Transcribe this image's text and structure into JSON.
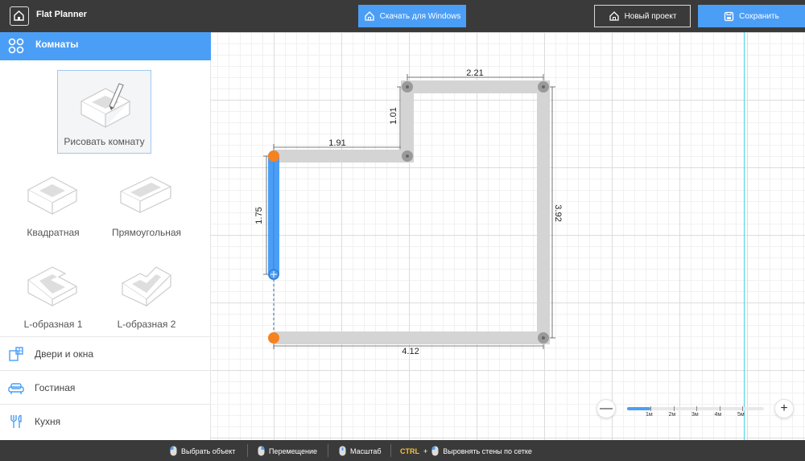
{
  "header": {
    "app_title": "Flat Planner",
    "download_label": "Скачать для Windows",
    "new_project_label": "Новый проект",
    "save_label": "Сохранить"
  },
  "sidebar": {
    "section_title": "Комнаты",
    "draw_room_label": "Рисовать комнату",
    "templates": [
      {
        "label": "Квадратная"
      },
      {
        "label": "Прямоугольная"
      },
      {
        "label": "L-образная 1"
      },
      {
        "label": "L-образная 2"
      }
    ],
    "categories": [
      {
        "label": "Двери и окна",
        "icon": "door-window-icon"
      },
      {
        "label": "Гостиная",
        "icon": "sofa-icon"
      },
      {
        "label": "Кухня",
        "icon": "cutlery-icon"
      }
    ]
  },
  "plan": {
    "dimensions": {
      "top": "2.21",
      "step_height": "1.01",
      "step_width": "1.91",
      "right": "3.92",
      "bottom": "4.12",
      "selected_wall": "1.75"
    }
  },
  "zoom": {
    "out_symbol": "—",
    "in_symbol": "+",
    "scale_fraction": 0.17,
    "ticks": [
      "1м",
      "2м",
      "3м",
      "4м",
      "5м"
    ]
  },
  "statusbar": {
    "select_hint": "Выбрать объект",
    "move_hint": "Перемещение",
    "zoom_hint": "Масштаб",
    "ctrl_key": "CTRL",
    "plus": "+",
    "align_hint": "Выровнять стены по сетке"
  },
  "colors": {
    "accent": "#4b9ef6",
    "header_bg": "#3a3a3a",
    "node_orange": "#f5821f",
    "wall_gray": "#d4d4d4",
    "guide_cyan": "#48d2e6"
  }
}
